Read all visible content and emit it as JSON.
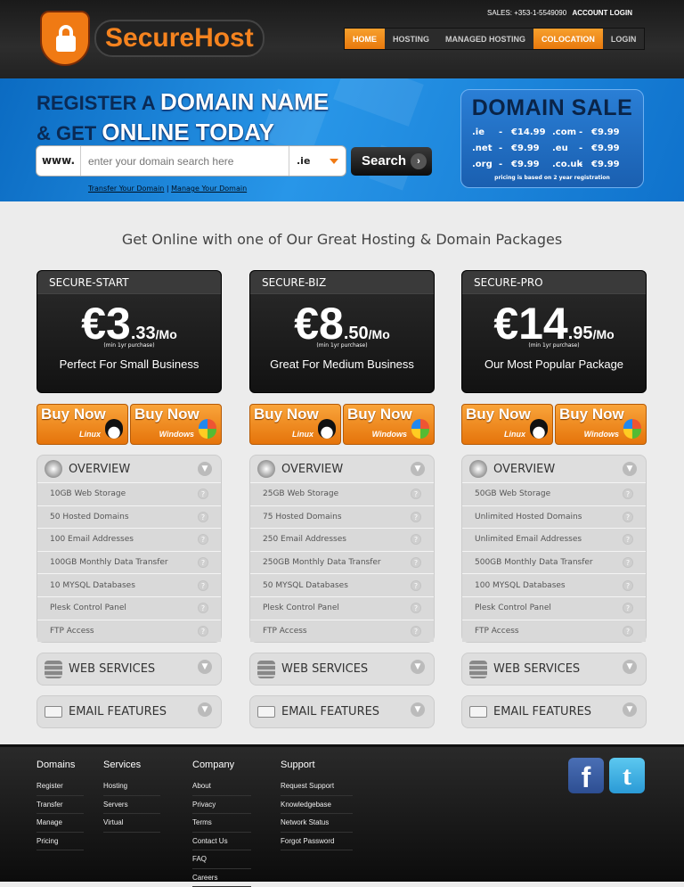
{
  "header": {
    "brand": "SecureHost",
    "sales": "SALES: +353-1-5549090",
    "account_login": "ACCOUNT LOGIN",
    "nav": [
      "HOME",
      "HOSTING",
      "MANAGED HOSTING",
      "COLOCATION",
      "LOGIN"
    ]
  },
  "hero": {
    "line1_a": "REGISTER A ",
    "line1_b": "DOMAIN NAME",
    "line2_a": "& GET ",
    "line2_b": "ONLINE TODAY",
    "www": "www.",
    "placeholder": "enter your domain search here",
    "tld": ".ie",
    "search_label": "Search",
    "transfer_link": "Transfer Your Domain",
    "separator": " | ",
    "manage_link": "Manage Your Domain"
  },
  "sale": {
    "title": "DOMAIN SALE",
    "rows": [
      [
        {
          "tld": ".ie",
          "price": "€14.99"
        },
        {
          "tld": ".com",
          "price": "€9.99"
        }
      ],
      [
        {
          "tld": ".net",
          "price": "€9.99"
        },
        {
          "tld": ".eu",
          "price": "€9.99"
        }
      ],
      [
        {
          "tld": ".org",
          "price": "€9.99"
        },
        {
          "tld": ".co.uk",
          "price": "€9.99"
        }
      ]
    ],
    "dash": "-",
    "note": "pricing is based on 2 year registration"
  },
  "main": {
    "title": "Get Online with one of Our Great Hosting & Domain Packages"
  },
  "plans": [
    {
      "name": "SECURE-START",
      "euros": "€3",
      "cents": ".33",
      "per": "/Mo",
      "min": "(min 1yr purchase)",
      "desc": "Perfect For Small Business",
      "features": [
        "10GB Web Storage",
        "50 Hosted Domains",
        "100 Email Addresses",
        "100GB Monthly Data Transfer",
        "10 MYSQL Databases",
        "Plesk Control Panel",
        "FTP Access"
      ]
    },
    {
      "name": "SECURE-BIZ",
      "euros": "€8",
      "cents": ".50",
      "per": "/Mo",
      "min": "(min 1yr purchase)",
      "desc": "Great For Medium Business",
      "features": [
        "25GB Web Storage",
        "75 Hosted Domains",
        "250 Email Addresses",
        "250GB Monthly Data Transfer",
        "50 MYSQL Databases",
        "Plesk Control Panel",
        "FTP Access"
      ]
    },
    {
      "name": "SECURE-PRO",
      "euros": "€14",
      "cents": ".95",
      "per": "/Mo",
      "min": "(min 1yr purchase)",
      "desc": "Our Most Popular Package",
      "features": [
        "50GB Web Storage",
        "Unlimited Hosted Domains",
        "Unlimited Email Addresses",
        "500GB Monthly Data Transfer",
        "100 MYSQL Databases",
        "Plesk Control Panel",
        "FTP Access"
      ]
    }
  ],
  "buy": {
    "label": "Buy Now",
    "linux": "Linux",
    "windows": "Windows"
  },
  "sections": {
    "overview": "OVERVIEW",
    "web": "WEB SERVICES",
    "email": "EMAIL FEATURES",
    "q": "?"
  },
  "footer": {
    "cols": [
      {
        "title": "Domains",
        "links": [
          "Register",
          "Transfer",
          "Manage",
          "Pricing"
        ]
      },
      {
        "title": "Services",
        "links": [
          "Hosting",
          "Servers",
          "Virtual"
        ]
      },
      {
        "title": "Company",
        "links": [
          "About",
          "Privacy",
          "Terms",
          "Contact Us",
          "FAQ",
          "Careers"
        ]
      },
      {
        "title": "Support",
        "links": [
          "Request Support",
          "Knowledgebase",
          "Network Status",
          "Forgot Password"
        ]
      }
    ],
    "facebook_glyph": "f",
    "twitter_glyph": "t"
  }
}
